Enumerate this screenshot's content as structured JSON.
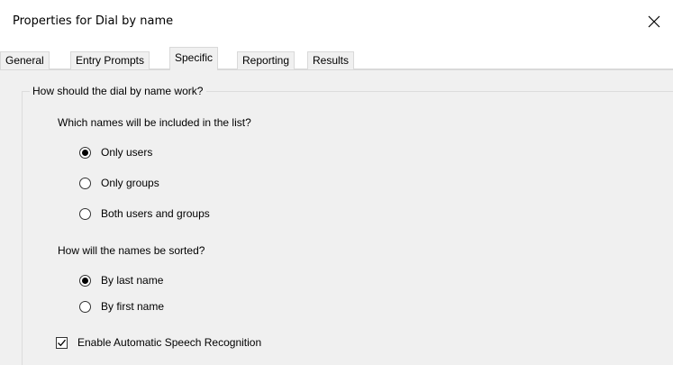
{
  "window": {
    "title": "Properties for Dial by name",
    "close_icon": "close-icon"
  },
  "tabs": [
    {
      "label": "General",
      "active": false
    },
    {
      "label": "Entry Prompts",
      "active": false
    },
    {
      "label": "Specific",
      "active": true
    },
    {
      "label": "Reporting",
      "active": false
    },
    {
      "label": "Results",
      "active": false
    }
  ],
  "group": {
    "legend": "How should the dial by name work?"
  },
  "names_included": {
    "question": "Which names will be included in the list?",
    "options": [
      {
        "label": "Only users",
        "selected": true
      },
      {
        "label": "Only groups",
        "selected": false
      },
      {
        "label": "Both users and groups",
        "selected": false
      }
    ]
  },
  "sorting": {
    "question": "How will the names be sorted?",
    "options": [
      {
        "label": "By last name",
        "selected": true
      },
      {
        "label": "By first name",
        "selected": false
      }
    ]
  },
  "asr": {
    "label": "Enable Automatic Speech Recognition",
    "checked": true
  }
}
